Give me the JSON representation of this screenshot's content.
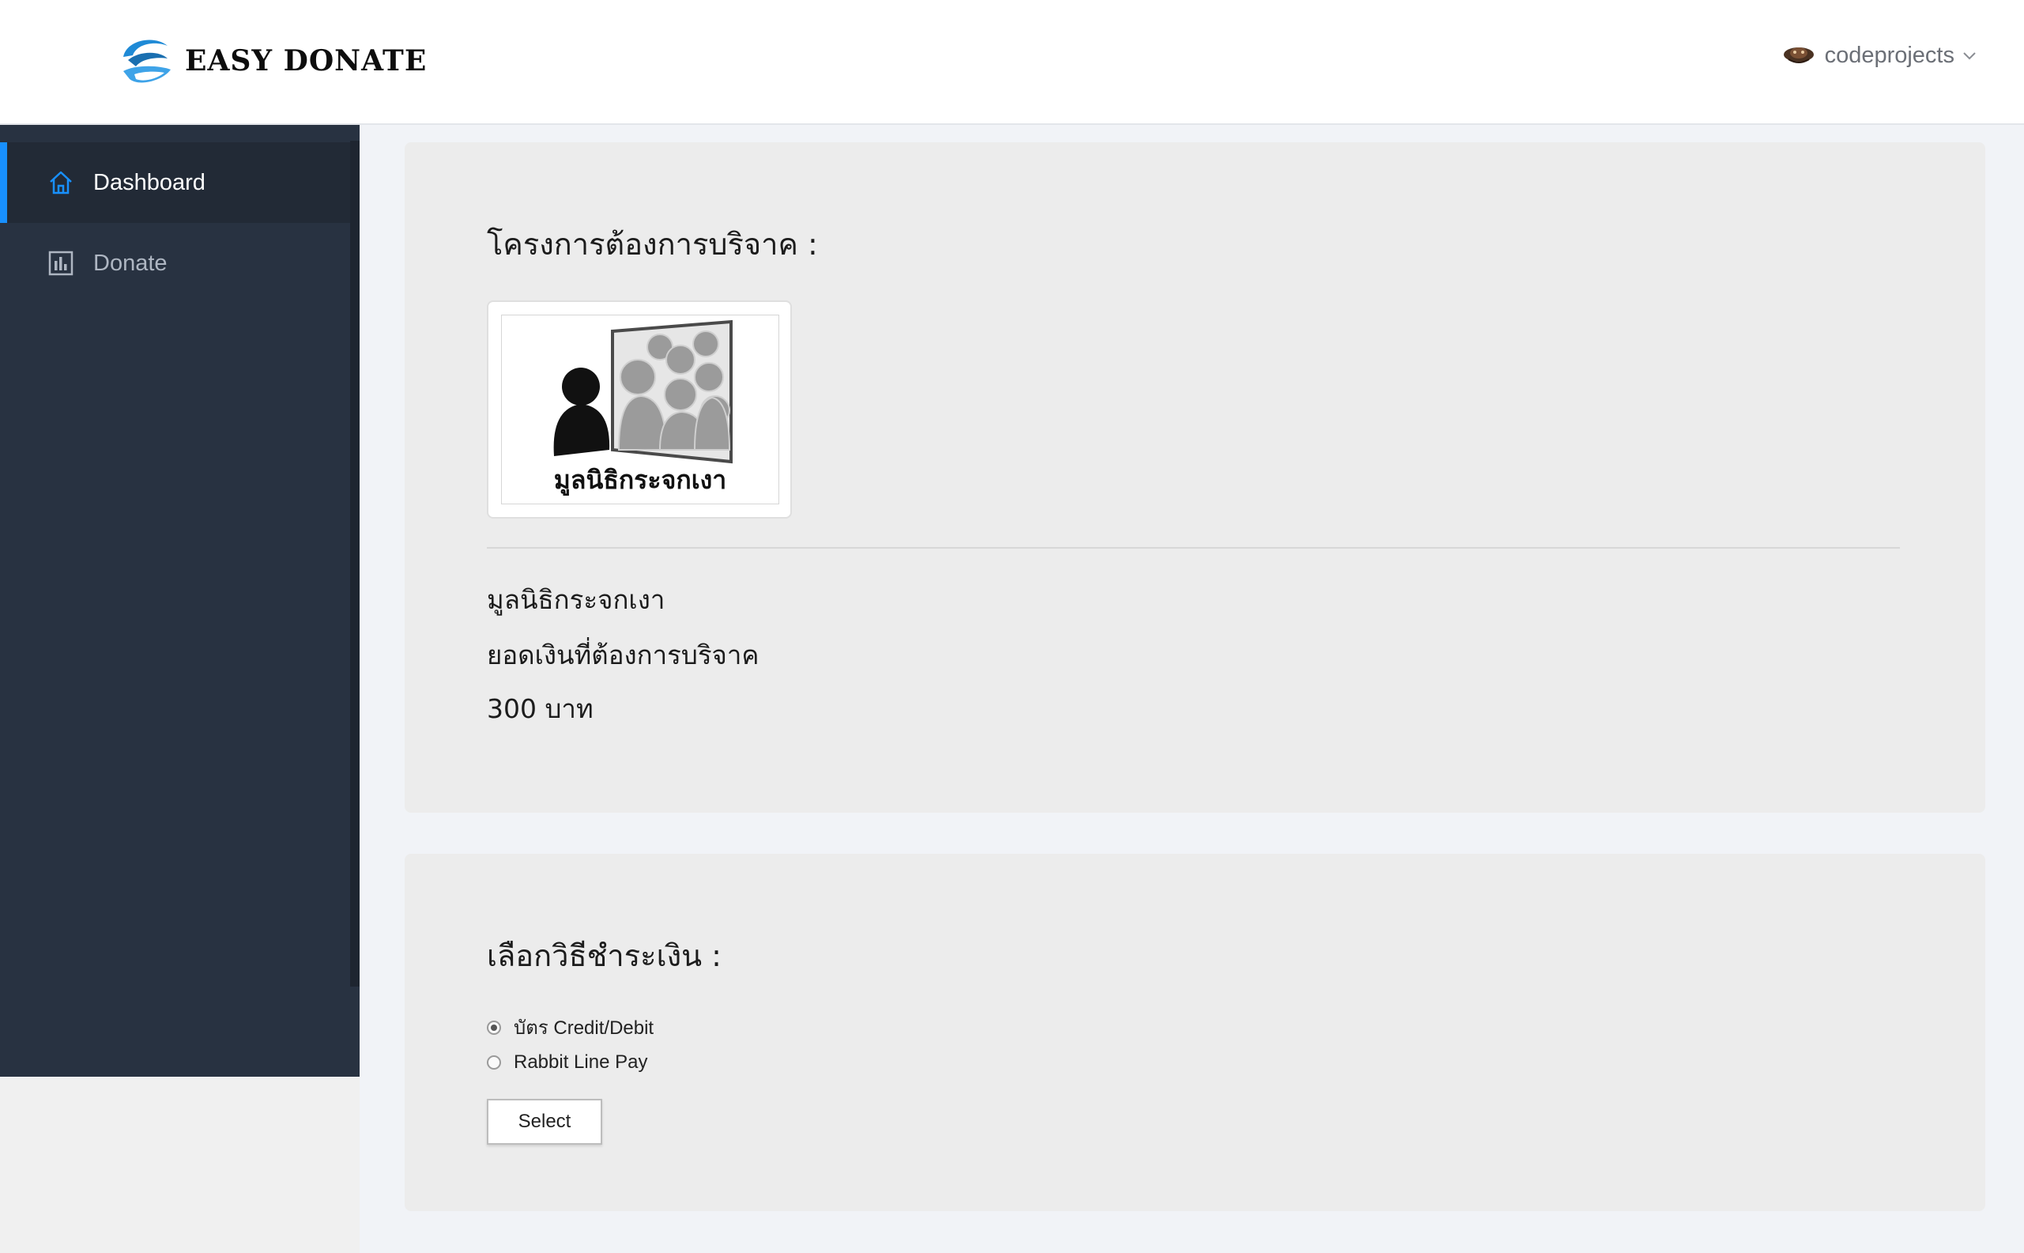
{
  "header": {
    "brand": "EASY DONATE",
    "username": "codeprojects",
    "brand_color": "#1f8ad6"
  },
  "sidebar": {
    "accent": "#1890ff",
    "items": [
      {
        "label": "Dashboard",
        "icon": "home-icon",
        "active": true
      },
      {
        "label": "Donate",
        "icon": "chart-icon",
        "active": false
      }
    ]
  },
  "project": {
    "heading": "โครงการต้องการบริจาค :",
    "logo_caption": "มูลนิธิกระจกเงา",
    "name": "มูลนิธิกระจกเงา",
    "amount_label": "ยอดเงินที่ต้องการบริจาค",
    "amount": "300 บาท"
  },
  "payment": {
    "heading": "เลือกวิธีชำระเงิน :",
    "options": [
      {
        "label": "บัตร Credit/Debit",
        "selected": true
      },
      {
        "label": "Rabbit Line Pay",
        "selected": false
      }
    ],
    "button": "Select"
  }
}
